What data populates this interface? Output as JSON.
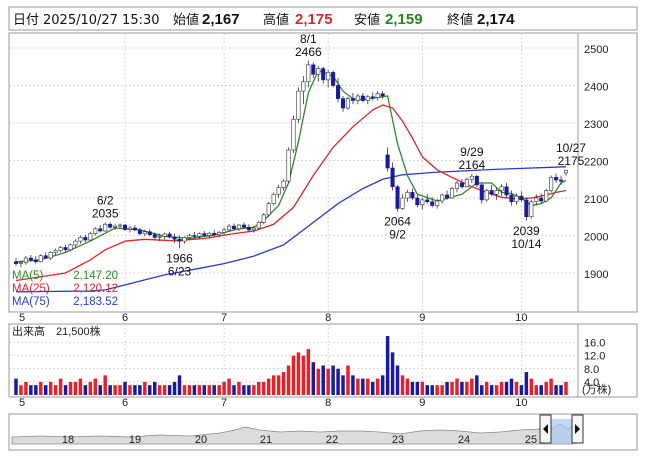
{
  "header": {
    "date_label": "日付",
    "date_value": "2025/10/27 15:30",
    "open_label": "始値",
    "open_value": "2,167",
    "high_label": "高値",
    "high_value": "2,175",
    "low_label": "安値",
    "low_value": "2,159",
    "close_label": "終値",
    "close_value": "2,174"
  },
  "colors": {
    "up": "#e8202a",
    "down": "#1a1aa0",
    "ma5": "#2e8b2e",
    "ma25": "#e0252b",
    "ma75": "#2a3cc8",
    "grid": "#c8c8c8",
    "text_high": "#e0252b",
    "text_low": "#1f8a1f"
  },
  "ma_legend": [
    {
      "label": "MA(5)",
      "value": "2,147.20"
    },
    {
      "label": "MA(25)",
      "value": "2,120.12"
    },
    {
      "label": "MA(75)",
      "value": "2,183.52"
    }
  ],
  "volume_header": {
    "label": "出来高",
    "value": "21,500株"
  },
  "volume_unit": "(万株)",
  "annotations": [
    {
      "date": "8/1",
      "price": "2466"
    },
    {
      "date": "6/2",
      "price": "2035"
    },
    {
      "date": "6/23",
      "price": "1966"
    },
    {
      "date": "9/2",
      "price": "2064"
    },
    {
      "date": "9/29",
      "price": "2164"
    },
    {
      "date": "10/14",
      "price": "2039"
    },
    {
      "date": "10/27",
      "price": "2175"
    }
  ],
  "navigator_labels": [
    "18",
    "19",
    "20",
    "21",
    "22",
    "23",
    "24",
    "25"
  ],
  "chart_data": [
    {
      "type": "candlestick",
      "title": "",
      "price_ticks": [
        "2500",
        "2400",
        "2300",
        "2200",
        "2100",
        "2000",
        "1900"
      ],
      "ylim": [
        1820,
        2545
      ],
      "month_ticks": [
        "5",
        "6",
        "7",
        "8",
        "9",
        "10"
      ],
      "xlim": [
        0,
        124
      ],
      "month_positions": [
        0,
        22,
        42,
        63,
        82,
        102
      ],
      "grid": true,
      "candles": [
        [
          1930,
          1940,
          1918,
          1925
        ],
        [
          1925,
          1932,
          1915,
          1928
        ],
        [
          1928,
          1945,
          1922,
          1940
        ],
        [
          1940,
          1948,
          1930,
          1935
        ],
        [
          1935,
          1945,
          1925,
          1930
        ],
        [
          1930,
          1950,
          1928,
          1946
        ],
        [
          1946,
          1955,
          1938,
          1940
        ],
        [
          1940,
          1958,
          1935,
          1955
        ],
        [
          1955,
          1965,
          1948,
          1960
        ],
        [
          1960,
          1972,
          1955,
          1968
        ],
        [
          1968,
          1975,
          1955,
          1962
        ],
        [
          1962,
          1978,
          1958,
          1975
        ],
        [
          1975,
          1990,
          1968,
          1985
        ],
        [
          1985,
          2000,
          1978,
          1995
        ],
        [
          1995,
          2002,
          1982,
          1988
        ],
        [
          1988,
          2010,
          1985,
          2005
        ],
        [
          2005,
          2022,
          2000,
          2018
        ],
        [
          2018,
          2028,
          2008,
          2012
        ],
        [
          2012,
          2035,
          2010,
          2030
        ],
        [
          2030,
          2035,
          2018,
          2022
        ],
        [
          2022,
          2030,
          2015,
          2025
        ],
        [
          2025,
          2032,
          2018,
          2028
        ],
        [
          2028,
          2030,
          2012,
          2016
        ],
        [
          2016,
          2025,
          2008,
          2020
        ],
        [
          2020,
          2028,
          2012,
          2015
        ],
        [
          2015,
          2020,
          2000,
          2005
        ],
        [
          2005,
          2015,
          1998,
          2010
        ],
        [
          2010,
          2018,
          1998,
          2002
        ],
        [
          2002,
          2008,
          1990,
          1995
        ],
        [
          1995,
          2005,
          1985,
          1998
        ],
        [
          1998,
          2008,
          1990,
          2004
        ],
        [
          2004,
          2010,
          1992,
          1996
        ],
        [
          1996,
          2005,
          1980,
          1990
        ],
        [
          1990,
          2000,
          1966,
          1985
        ],
        [
          1985,
          1998,
          1978,
          1995
        ],
        [
          1995,
          2005,
          1988,
          2000
        ],
        [
          2000,
          2010,
          1992,
          1998
        ],
        [
          1998,
          2008,
          1990,
          2005
        ],
        [
          2005,
          2012,
          1995,
          2000
        ],
        [
          2000,
          2010,
          1992,
          2006
        ],
        [
          2006,
          2015,
          1998,
          2002
        ],
        [
          2002,
          2012,
          1995,
          2008
        ],
        [
          2008,
          2020,
          2000,
          2015
        ],
        [
          2015,
          2030,
          2010,
          2025
        ],
        [
          2025,
          2032,
          2015,
          2018
        ],
        [
          2018,
          2030,
          2012,
          2028
        ],
        [
          2028,
          2035,
          2018,
          2022
        ],
        [
          2022,
          2030,
          2010,
          2015
        ],
        [
          2015,
          2025,
          2008,
          2020
        ],
        [
          2020,
          2040,
          2015,
          2035
        ],
        [
          2035,
          2060,
          2030,
          2055
        ],
        [
          2055,
          2090,
          2050,
          2085
        ],
        [
          2085,
          2115,
          2080,
          2110
        ],
        [
          2110,
          2135,
          2100,
          2128
        ],
        [
          2128,
          2150,
          2120,
          2145
        ],
        [
          2145,
          2235,
          2140,
          2228
        ],
        [
          2228,
          2320,
          2220,
          2310
        ],
        [
          2310,
          2395,
          2300,
          2385
        ],
        [
          2385,
          2425,
          2350,
          2410
        ],
        [
          2410,
          2466,
          2395,
          2455
        ],
        [
          2455,
          2462,
          2420,
          2430
        ],
        [
          2430,
          2452,
          2410,
          2445
        ],
        [
          2445,
          2450,
          2405,
          2415
        ],
        [
          2415,
          2442,
          2395,
          2435
        ],
        [
          2435,
          2440,
          2395,
          2400
        ],
        [
          2400,
          2420,
          2355,
          2365
        ],
        [
          2365,
          2372,
          2330,
          2340
        ],
        [
          2340,
          2370,
          2335,
          2365
        ],
        [
          2365,
          2380,
          2350,
          2360
        ],
        [
          2360,
          2378,
          2350,
          2372
        ],
        [
          2372,
          2380,
          2355,
          2360
        ],
        [
          2360,
          2375,
          2350,
          2370
        ],
        [
          2370,
          2382,
          2360,
          2368
        ],
        [
          2368,
          2385,
          2360,
          2378
        ],
        [
          2378,
          2385,
          2365,
          2372
        ],
        [
          2215,
          2235,
          2170,
          2180
        ],
        [
          2180,
          2195,
          2120,
          2130
        ],
        [
          2130,
          2135,
          2064,
          2072
        ],
        [
          2072,
          2110,
          2068,
          2100
        ],
        [
          2100,
          2122,
          2090,
          2115
        ],
        [
          2115,
          2125,
          2095,
          2100
        ],
        [
          2100,
          2108,
          2075,
          2082
        ],
        [
          2082,
          2100,
          2070,
          2095
        ],
        [
          2095,
          2110,
          2085,
          2090
        ],
        [
          2090,
          2102,
          2075,
          2080
        ],
        [
          2080,
          2098,
          2072,
          2092
        ],
        [
          2092,
          2112,
          2085,
          2108
        ],
        [
          2108,
          2120,
          2095,
          2100
        ],
        [
          2100,
          2130,
          2098,
          2125
        ],
        [
          2125,
          2145,
          2115,
          2140
        ],
        [
          2140,
          2150,
          2125,
          2130
        ],
        [
          2130,
          2155,
          2128,
          2150
        ],
        [
          2150,
          2164,
          2140,
          2158
        ],
        [
          2158,
          2162,
          2130,
          2135
        ],
        [
          2135,
          2142,
          2085,
          2095
        ],
        [
          2095,
          2125,
          2090,
          2120
        ],
        [
          2120,
          2135,
          2105,
          2110
        ],
        [
          2110,
          2128,
          2095,
          2120
        ],
        [
          2120,
          2138,
          2105,
          2130
        ],
        [
          2130,
          2140,
          2100,
          2108
        ],
        [
          2108,
          2120,
          2080,
          2090
        ],
        [
          2090,
          2112,
          2082,
          2105
        ],
        [
          2105,
          2118,
          2090,
          2095
        ],
        [
          2095,
          2102,
          2039,
          2050
        ],
        [
          2050,
          2095,
          2045,
          2090
        ],
        [
          2090,
          2110,
          2080,
          2100
        ],
        [
          2100,
          2112,
          2085,
          2092
        ],
        [
          2092,
          2125,
          2088,
          2120
        ],
        [
          2120,
          2160,
          2115,
          2155
        ],
        [
          2155,
          2165,
          2140,
          2148
        ],
        [
          2148,
          2160,
          2135,
          2145
        ],
        [
          2167,
          2175,
          2159,
          2174
        ]
      ],
      "volume_ticks": [
        "16.0",
        "12.0",
        "8.0",
        "4.0"
      ],
      "volume_max": 18,
      "volume": [
        5,
        3,
        4,
        3,
        3,
        4,
        3,
        4,
        3,
        5,
        3,
        4,
        4,
        5,
        3,
        4,
        5,
        3,
        6,
        3,
        3,
        3,
        4,
        3,
        3,
        3,
        4,
        3,
        4,
        3,
        3,
        3,
        4,
        6,
        3,
        3,
        3,
        3,
        3,
        3,
        3,
        3,
        4,
        5,
        3,
        4,
        3,
        3,
        3,
        4,
        4,
        5,
        6,
        6,
        7,
        9,
        12,
        13,
        12,
        14,
        10,
        8,
        9,
        8,
        9,
        8,
        6,
        9,
        6,
        5,
        5,
        5,
        4,
        5,
        6,
        18,
        13,
        9,
        6,
        5,
        4,
        4,
        4,
        3,
        3,
        3,
        3,
        4,
        4,
        5,
        4,
        4,
        5,
        6,
        3,
        4,
        3,
        3,
        4,
        4,
        5,
        4,
        3,
        7,
        5,
        3,
        3,
        4,
        5,
        3,
        3,
        4
      ],
      "ma5": [
        [
          0,
          1930
        ],
        [
          5,
          1935
        ],
        [
          10,
          1955
        ],
        [
          15,
          1985
        ],
        [
          20,
          2020
        ],
        [
          25,
          2015
        ],
        [
          30,
          1998
        ],
        [
          35,
          1992
        ],
        [
          40,
          2001
        ],
        [
          45,
          2018
        ],
        [
          48,
          2022
        ],
        [
          50,
          2040
        ],
        [
          53,
          2080
        ],
        [
          55,
          2140
        ],
        [
          57,
          2250
        ],
        [
          59,
          2380
        ],
        [
          61,
          2440
        ],
        [
          64,
          2425
        ],
        [
          66,
          2385
        ],
        [
          68,
          2365
        ],
        [
          70,
          2362
        ],
        [
          73,
          2368
        ],
        [
          75,
          2372
        ],
        [
          77,
          2245
        ],
        [
          79,
          2160
        ],
        [
          81,
          2110
        ],
        [
          85,
          2092
        ],
        [
          90,
          2110
        ],
        [
          93,
          2140
        ],
        [
          96,
          2140
        ],
        [
          98,
          2115
        ],
        [
          100,
          2112
        ],
        [
          102,
          2100
        ],
        [
          104,
          2080
        ],
        [
          106,
          2085
        ],
        [
          108,
          2100
        ],
        [
          110,
          2140
        ],
        [
          111,
          2147
        ]
      ],
      "ma25": [
        [
          0,
          1880
        ],
        [
          10,
          1900
        ],
        [
          15,
          1935
        ],
        [
          18,
          1962
        ],
        [
          22,
          1985
        ],
        [
          26,
          1990
        ],
        [
          32,
          1986
        ],
        [
          38,
          1992
        ],
        [
          44,
          2005
        ],
        [
          48,
          2012
        ],
        [
          52,
          2030
        ],
        [
          56,
          2075
        ],
        [
          60,
          2160
        ],
        [
          64,
          2235
        ],
        [
          68,
          2290
        ],
        [
          72,
          2335
        ],
        [
          74,
          2348
        ],
        [
          76,
          2340
        ],
        [
          78,
          2305
        ],
        [
          80,
          2260
        ],
        [
          82,
          2210
        ],
        [
          85,
          2175
        ],
        [
          88,
          2155
        ],
        [
          92,
          2130
        ],
        [
          95,
          2115
        ],
        [
          98,
          2102
        ],
        [
          101,
          2098
        ],
        [
          104,
          2100
        ],
        [
          107,
          2108
        ],
        [
          109,
          2115
        ],
        [
          111,
          2120
        ]
      ],
      "ma75": [
        [
          0,
          1850
        ],
        [
          15,
          1852
        ],
        [
          18,
          1855
        ],
        [
          24,
          1875
        ],
        [
          30,
          1895
        ],
        [
          36,
          1910
        ],
        [
          42,
          1925
        ],
        [
          48,
          1945
        ],
        [
          54,
          1975
        ],
        [
          60,
          2035
        ],
        [
          65,
          2085
        ],
        [
          70,
          2125
        ],
        [
          74,
          2150
        ],
        [
          78,
          2162
        ],
        [
          84,
          2168
        ],
        [
          90,
          2172
        ],
        [
          96,
          2176
        ],
        [
          102,
          2179
        ],
        [
          108,
          2182
        ],
        [
          111,
          2183.5
        ]
      ]
    }
  ]
}
